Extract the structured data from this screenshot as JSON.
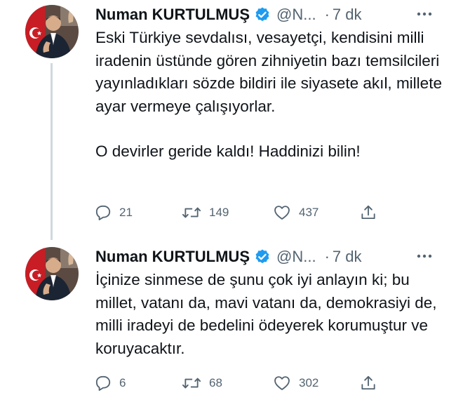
{
  "tweets": [
    {
      "author": {
        "name": "Numan KURTULMUŞ",
        "handle": "@N...",
        "verified": true
      },
      "separator": "·",
      "time": "7 dk",
      "paragraphs": [
        "Eski Türkiye sevdalısı, vesayetçi, kendisini milli iradenin üstünde gören zihniyetin bazı temsilcileri yayınladıkları sözde bildiri ile siyasete akıl, millete ayar vermeye çalışıyorlar.",
        "O devirler geride kaldı! Haddinizi bilin!"
      ],
      "stats": {
        "replies": "21",
        "retweets": "149",
        "likes": "437"
      },
      "icons": {
        "reply": "reply-icon",
        "retweet": "retweet-icon",
        "like": "heart-icon",
        "share": "share-icon",
        "more": "more-icon"
      }
    },
    {
      "author": {
        "name": "Numan KURTULMUŞ",
        "handle": "@N...",
        "verified": true
      },
      "separator": "·",
      "time": "7 dk",
      "paragraphs": [
        "İçinize sinmese de şunu çok iyi anlayın ki; bu millet, vatanı da, mavi vatanı da, demokrasiyi de, milli iradeyi de bedelini ödeyerek korumuştur ve koruyacaktır."
      ],
      "stats": {
        "replies": "6",
        "retweets": "68",
        "likes": "302"
      },
      "icons": {
        "reply": "reply-icon",
        "retweet": "retweet-icon",
        "like": "heart-icon",
        "share": "share-icon",
        "more": "more-icon"
      }
    }
  ],
  "colors": {
    "text": "#0f1419",
    "secondary": "#536471",
    "verified_badge": "#1d9bf0",
    "thread_line": "#cfd9de"
  }
}
